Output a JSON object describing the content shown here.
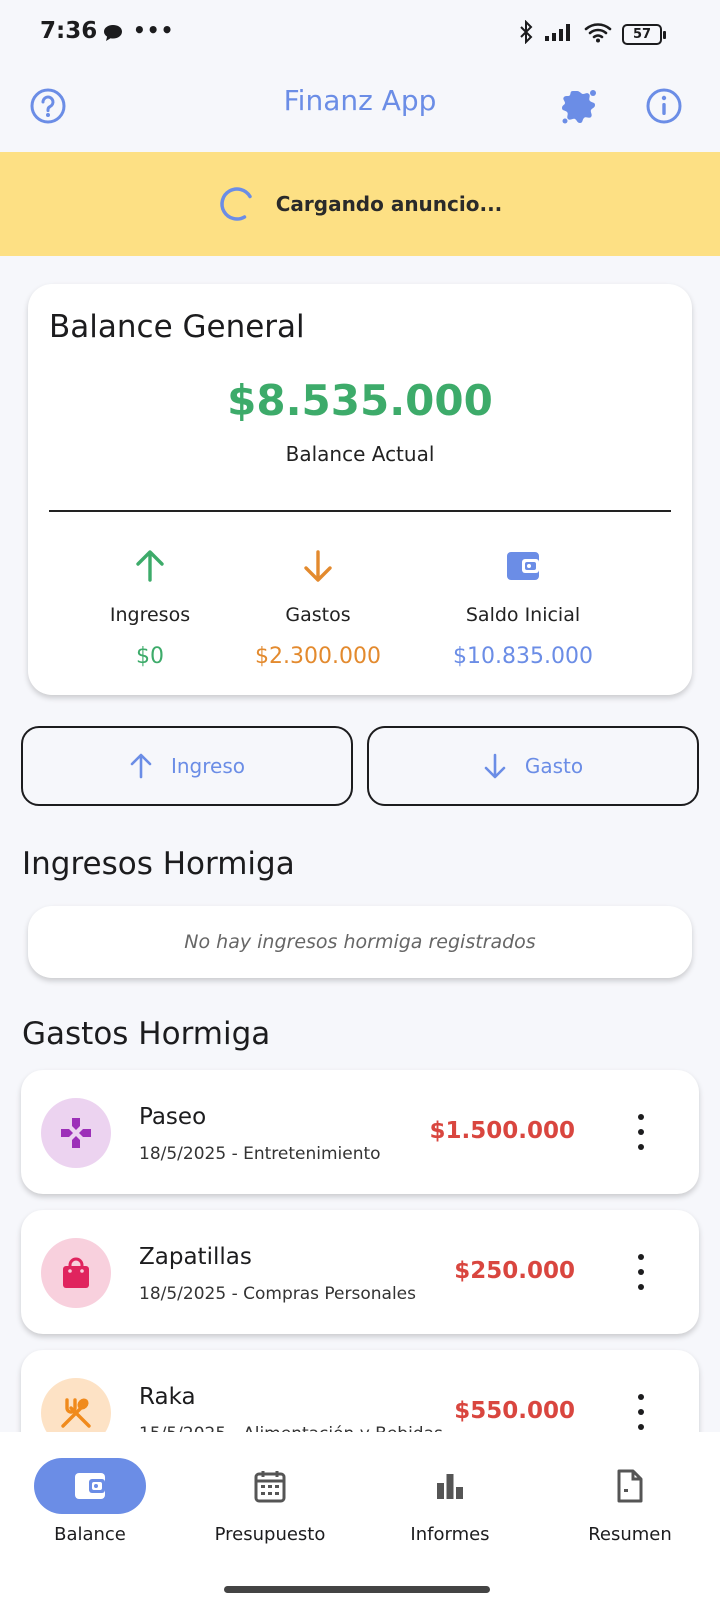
{
  "status_bar": {
    "time": "7:36",
    "battery": "57"
  },
  "app_bar": {
    "title": "Finanz App"
  },
  "ad_banner": {
    "text": "Cargando anuncio..."
  },
  "balance": {
    "title": "Balance General",
    "amount": "$8.535.000",
    "subtitle": "Balance Actual",
    "income": {
      "label": "Ingresos",
      "value": "$0",
      "color": "#3dab6a"
    },
    "expenses": {
      "label": "Gastos",
      "value": "$2.300.000",
      "color": "#e38a2e"
    },
    "initial": {
      "label": "Saldo Inicial",
      "value": "$10.835.000",
      "color": "#6b8de6"
    }
  },
  "actions": {
    "income_label": "Ingreso",
    "expense_label": "Gasto"
  },
  "income_section": {
    "title": "Ingresos Hormiga",
    "empty_text": "No hay ingresos hormiga registrados"
  },
  "expense_section": {
    "title": "Gastos Hormiga",
    "items": [
      {
        "name": "Paseo",
        "subtitle": "18/5/2025 - Entretenimiento",
        "amount": "$1.500.000",
        "icon": "gamepad-icon",
        "icon_bg": "#ecd3f0",
        "icon_color": "#9c2fb8"
      },
      {
        "name": "Zapatillas",
        "subtitle": "18/5/2025 - Compras Personales",
        "amount": "$250.000",
        "icon": "shopping-bag-icon",
        "icon_bg": "#f8d0dd",
        "icon_color": "#e0245e"
      },
      {
        "name": "Raka",
        "subtitle": "15/5/2025 - Alimentación y Bebidas",
        "amount": "$550.000",
        "icon": "utensils-icon",
        "icon_bg": "#fde2c5",
        "icon_color": "#f08a1c"
      }
    ]
  },
  "bottom_nav": {
    "items": [
      {
        "label": "Balance",
        "icon": "wallet-icon",
        "active": true
      },
      {
        "label": "Presupuesto",
        "icon": "calendar-icon",
        "active": false
      },
      {
        "label": "Informes",
        "icon": "bar-chart-icon",
        "active": false
      },
      {
        "label": "Resumen",
        "icon": "document-icon",
        "active": false
      }
    ]
  },
  "colors": {
    "accent": "#6b8de6",
    "green": "#3dab6a",
    "orange": "#e38a2e",
    "red": "#d9463f",
    "ad_bg": "#fde084"
  }
}
